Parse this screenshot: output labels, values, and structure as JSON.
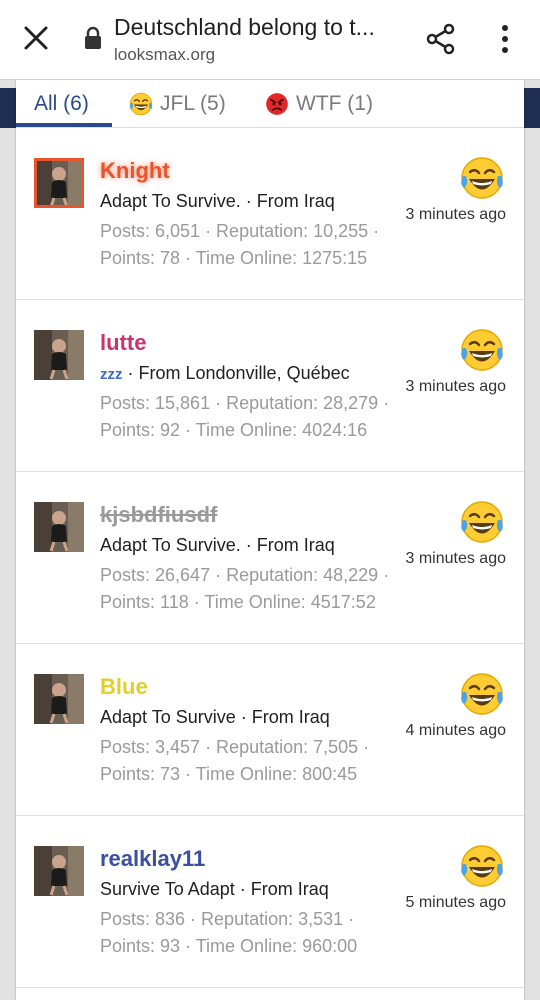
{
  "browser": {
    "title": "Deutschland belong to t...",
    "url": "looksmax.org",
    "icons": [
      "close-icon",
      "lock-icon",
      "share-icon",
      "more-vert-icon"
    ]
  },
  "tabs": [
    {
      "label": "All (6)",
      "active": true
    },
    {
      "label": "JFL (5)",
      "emoji": "laughing-crying-emoji"
    },
    {
      "label": "WTF (1)",
      "emoji": "angry-face-emoji"
    }
  ],
  "colors": {
    "accent": "#2b4a8c",
    "emoji_yellow": "#ffcc33",
    "angry_red": "#e02828",
    "tear_blue": "#4fa3e0"
  },
  "reactions": [
    {
      "username": "Knight",
      "username_color": "#e8542c",
      "username_glow": true,
      "bio": "Adapt To Survive. · From Iraq",
      "stats": "Posts: 6,051 · Reputation: 10,255 · Points: 78 · Time Online: 1275:15",
      "time": "3 minutes ago",
      "reaction": "laughing-crying-emoji"
    },
    {
      "username": "lutte",
      "username_color": "#c8326e",
      "bio_prefix": "zzz",
      "bio": " · From Londonville, Québec",
      "stats": "Posts: 15,861 · Reputation: 28,279 · Points: 92 · Time Online: 4024:16",
      "time": "3 minutes ago",
      "reaction": "laughing-crying-emoji"
    },
    {
      "username": "kjsbdfiusdf",
      "username_color": "#9a9a9a",
      "username_struck": true,
      "bio": "Adapt To Survive. · From Iraq",
      "stats": "Posts: 26,647 · Reputation: 48,229 · Points: 118 · Time Online: 4517:52",
      "time": "3 minutes ago",
      "reaction": "laughing-crying-emoji"
    },
    {
      "username": "Blue",
      "username_color": "#e2cf2a",
      "bio": "Adapt To Survive · From Iraq",
      "stats": "Posts: 3,457 · Reputation: 7,505 · Points: 73 · Time Online: 800:45",
      "time": "4 minutes ago",
      "reaction": "laughing-crying-emoji"
    },
    {
      "username": "realklay11",
      "username_color": "#3a4fa0",
      "bio": "Survive To Adapt · From Iraq",
      "stats": "Posts: 836 · Reputation: 3,531 · Points: 93 · Time Online: 960:00",
      "time": "5 minutes ago",
      "reaction": "laughing-crying-emoji"
    }
  ]
}
